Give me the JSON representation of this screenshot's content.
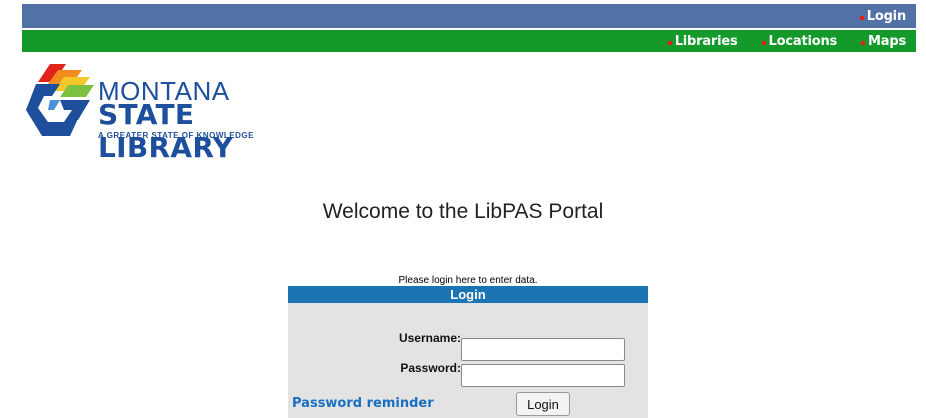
{
  "top_bar": {
    "login_link": "Login"
  },
  "nav": {
    "items": [
      {
        "label": "Libraries"
      },
      {
        "label": "Locations"
      },
      {
        "label": "Maps"
      }
    ]
  },
  "logo": {
    "line1": "MONTANA",
    "line2": "STATE LIBRARY",
    "tagline": "A GREATER STATE OF KNOWLEDGE"
  },
  "welcome": "Welcome to the LibPAS Portal",
  "login_prompt": "Please login here to enter data.",
  "login_form": {
    "header": "Login",
    "username_label": "Username:",
    "username_value": "",
    "password_label": "Password:",
    "password_value": "",
    "reminder_link": "Password reminder",
    "submit_label": "Login"
  },
  "colors": {
    "top_bar": "#5272a6",
    "nav_bar": "#139a2b",
    "form_header": "#1b74b3",
    "form_bg": "#e3e3e3",
    "link": "#1a6fc0",
    "bullet": "#e2231a"
  }
}
